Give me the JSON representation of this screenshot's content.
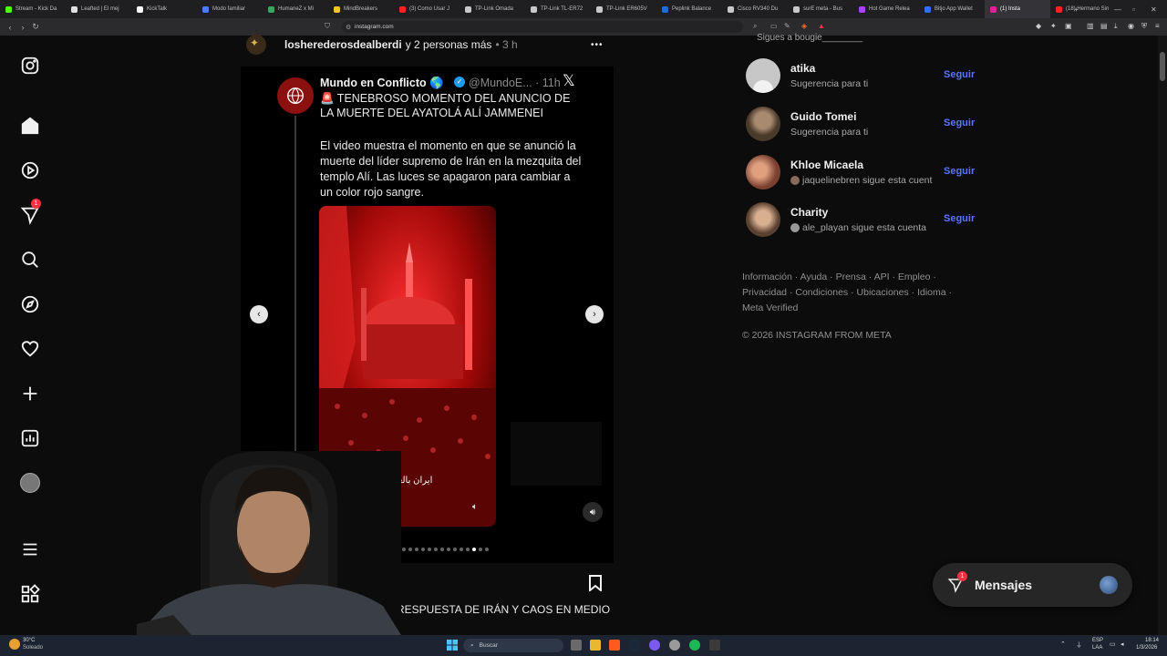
{
  "browser": {
    "tabs": [
      {
        "label": "Stream - Kick Da",
        "color": "#53fc18"
      },
      {
        "label": "Leafted | El mej",
        "color": "#e0e0e0"
      },
      {
        "label": "KickTalk",
        "color": "#ffffff"
      },
      {
        "label": "Modo familiar",
        "color": "#4a7cff"
      },
      {
        "label": "HumaneZ x Mi",
        "color": "#3aa55c"
      },
      {
        "label": "MindBreakers",
        "color": "#f2c230"
      },
      {
        "label": "(3) Como Usar J",
        "color": "#ff2020"
      },
      {
        "label": "TP-Link Omada",
        "color": "#c9c9c9"
      },
      {
        "label": "TP-Link TL-ER72",
        "color": "#c9c9c9"
      },
      {
        "label": "TP-Link ER605V",
        "color": "#c9c9c9"
      },
      {
        "label": "Peplink Balance",
        "color": "#1f6fd1"
      },
      {
        "label": "Cisco RV340 Du",
        "color": "#c9c9c9"
      },
      {
        "label": "surE meta - Bus",
        "color": "#c9c9c9"
      },
      {
        "label": "Hot Game Relea",
        "color": "#b040ff"
      },
      {
        "label": "Bitjo App Wallet",
        "color": "#3070ff"
      },
      {
        "label": "(1) Insta",
        "color": "#d6249f",
        "active": true
      },
      {
        "label": "(18) Hermano Sin",
        "color": "#ff2020"
      }
    ],
    "url": "instagram.com",
    "new_tab": "+"
  },
  "post": {
    "author": "losherederosdealberdi",
    "coauthors": "y 2 personas más",
    "time": "• 3 h",
    "more": "•••",
    "tweet": {
      "name": "Mundo en Conflicto 🌎",
      "handle": "@MundoE... · 11h",
      "title": "🚨 TENEBROSO MOMENTO DEL ANUNCIO DE LA MUERTE DEL AYATOLÁ ALÍ JAMMENEI",
      "body": "El video muestra el momento en que se anunció la muerte del líder supremo de Irán en la mezquita del templo Alí. Las luces se apagaron para cambiar a un color rojo sangre.",
      "watermark": "ایران بالعربية",
      "x_logo": "𝕏"
    },
    "caption": "RESPUESTA DE IRÁN Y CAOS EN MEDIO",
    "carousel": {
      "total": 14,
      "current": 11
    }
  },
  "nav": {
    "notifications_badge": "1"
  },
  "suggestions": {
    "top_partial": "Sigues a bougie________",
    "follow_label": "Seguir",
    "items": [
      {
        "name": "atika",
        "sub": "Sugerencia para ti",
        "avatar": "#c7c7c7"
      },
      {
        "name": "Guido Tomei",
        "sub": "Sugerencia para ti",
        "avatar": "#6a5a4a"
      },
      {
        "name": "Khloe Micaela",
        "sub": "jaquelinebren sigue esta cuent",
        "avatar": "#b07a60"
      },
      {
        "name": "Charity",
        "sub": "ale_playan sigue esta cuenta",
        "avatar": "#8a6a50"
      }
    ]
  },
  "footer": {
    "links": [
      "Información",
      "Ayuda",
      "Prensa",
      "API",
      "Empleo",
      "Privacidad",
      "Condiciones",
      "Ubicaciones",
      "Idioma",
      "Meta Verified"
    ],
    "copyright": "© 2026 INSTAGRAM FROM META"
  },
  "messages": {
    "label": "Mensajes",
    "badge": "1"
  },
  "taskbar": {
    "weather_temp": "30°C",
    "weather_desc": "Soleado",
    "search": "Buscar",
    "lang1": "ESP",
    "lang2": "LAA",
    "time": "18:14",
    "date": "1/3/2026"
  }
}
